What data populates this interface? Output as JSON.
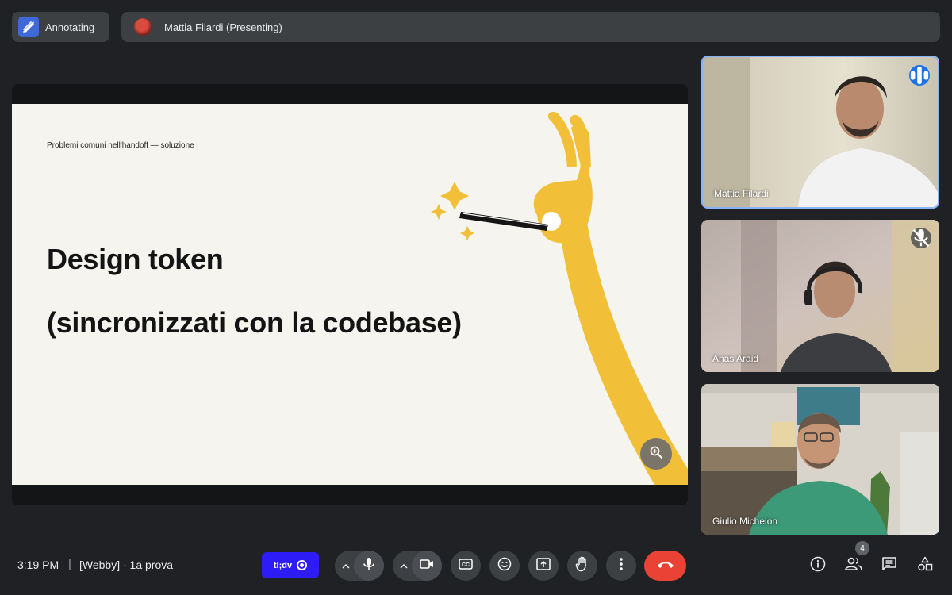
{
  "top_bar": {
    "annotating_label": "Annotating",
    "presenting_label": "Mattia Filardi (Presenting)"
  },
  "slide": {
    "caption": "Problemi comuni nell'handoff — soluzione",
    "title_line1": "Design token",
    "title_line2": "(sincronizzati con la codebase)"
  },
  "participants": [
    {
      "name": "Mattia Filardi",
      "status": "speaking"
    },
    {
      "name": "Anas Araid",
      "status": "muted"
    },
    {
      "name": "Giulio Michelon",
      "status": "none"
    }
  ],
  "bottom_bar": {
    "time": "3:19 PM",
    "separator": "|",
    "meeting_name": "[Webby] - 1a prova",
    "tldv_label": "tl;dv",
    "people_count": "4"
  },
  "colors": {
    "background": "#202124",
    "accent_blue": "#1a73e8",
    "end_call_red": "#ea4335",
    "tldv_blue": "#2d1cf5",
    "slide_yellow": "#f2bf38"
  },
  "icons": [
    "annotate-icon",
    "zoom-in-icon",
    "speaking-icon",
    "mic-off-icon",
    "mic-icon",
    "camera-icon",
    "captions-icon",
    "emoji-icon",
    "present-icon",
    "raise-hand-icon",
    "more-icon",
    "end-call-icon",
    "info-icon",
    "people-icon",
    "chat-icon",
    "activities-icon"
  ]
}
